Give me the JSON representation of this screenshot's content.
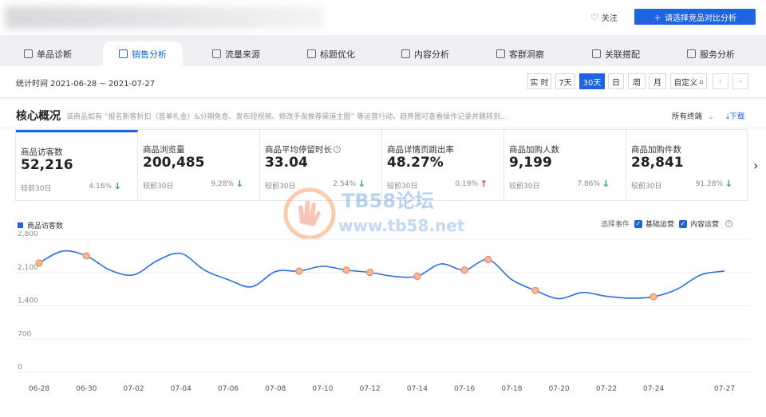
{
  "header": {
    "follow_label": "关注",
    "compare_label": "请选择竞品对比分析"
  },
  "tabs": [
    {
      "label": "单品诊断",
      "icon": "product-icon"
    },
    {
      "label": "销售分析",
      "icon": "bag-icon",
      "active": true
    },
    {
      "label": "流量来源",
      "icon": "traffic-icon"
    },
    {
      "label": "标题优化",
      "icon": "chart-icon"
    },
    {
      "label": "内容分析",
      "icon": "content-icon"
    },
    {
      "label": "客群洞察",
      "icon": "users-icon"
    },
    {
      "label": "关联搭配",
      "icon": "link-icon"
    },
    {
      "label": "服务分析",
      "icon": "headset-icon"
    }
  ],
  "date": {
    "range_label": "统计时间 2021-06-28 ~ 2021-07-27",
    "buttons": [
      "实 时",
      "7天",
      "30天",
      "日",
      "周",
      "月",
      "自定义"
    ],
    "active": "30天"
  },
  "core": {
    "title": "核心概况",
    "description": "该商品如有 “报名新客折扣（首单礼金）&分期免息、发布短视频、修改手淘推荐渠道主图” 等运营行动，趋势图可查看操作记录并跳转到...",
    "terminal_label": "所有终端",
    "download_label": "下载"
  },
  "cards": [
    {
      "label": "商品访客数",
      "value": "52,216",
      "compare": "较前30日",
      "pct": "4.16%",
      "direction": "down"
    },
    {
      "label": "商品浏览量",
      "value": "200,485",
      "compare": "较前30日",
      "pct": "9.28%",
      "direction": "down"
    },
    {
      "label": "商品平均停留时长",
      "value": "33.04",
      "compare": "较前30日",
      "pct": "2.54%",
      "direction": "down",
      "help": true
    },
    {
      "label": "商品详情页跳出率",
      "value": "48.27%",
      "compare": "较前30日",
      "pct": "0.19%",
      "direction": "up"
    },
    {
      "label": "商品加购人数",
      "value": "9,199",
      "compare": "较前30日",
      "pct": "7.86%",
      "direction": "down"
    },
    {
      "label": "商品加购件数",
      "value": "28,841",
      "compare": "较前30日",
      "pct": "91.28%",
      "direction": "down"
    }
  ],
  "events": {
    "label": "选择事件",
    "options": [
      "基础运营",
      "内容运营"
    ]
  },
  "watermark": {
    "line1": "TB58论坛",
    "line2": "www.tb58.net"
  },
  "chart_data": {
    "type": "line",
    "title": "",
    "xlabel": "",
    "ylabel": "",
    "ylim": [
      0,
      2800
    ],
    "yticks": [
      0,
      700,
      1400,
      2100,
      2800
    ],
    "ytick_labels": [
      "0",
      "700",
      "1,400",
      "2,100",
      "2,800"
    ],
    "x": [
      "06-28",
      "06-29",
      "06-30",
      "07-01",
      "07-02",
      "07-03",
      "07-04",
      "07-05",
      "07-06",
      "07-07",
      "07-08",
      "07-09",
      "07-10",
      "07-11",
      "07-12",
      "07-13",
      "07-14",
      "07-15",
      "07-16",
      "07-17",
      "07-18",
      "07-19",
      "07-20",
      "07-21",
      "07-22",
      "07-23",
      "07-24",
      "07-25",
      "07-26",
      "07-27"
    ],
    "xtick_labels": [
      "06-28",
      "06-30",
      "07-02",
      "07-04",
      "07-06",
      "07-08",
      "07-10",
      "07-12",
      "07-14",
      "07-16",
      "07-18",
      "07-20",
      "07-22",
      "07-24",
      "07-27"
    ],
    "series": [
      {
        "name": "商品访客数",
        "color": "#2f6fe3",
        "values": [
          2300,
          2550,
          2450,
          2150,
          2050,
          2350,
          2500,
          2150,
          1950,
          1800,
          2120,
          2130,
          2230,
          2150,
          2100,
          2020,
          2020,
          2280,
          2150,
          2370,
          1950,
          1720,
          1550,
          1680,
          1600,
          1560,
          1590,
          1750,
          2050,
          2130
        ]
      }
    ],
    "event_markers": [
      "06-28",
      "06-30",
      "07-09",
      "07-11",
      "07-12",
      "07-14",
      "07-16",
      "07-17",
      "07-19",
      "07-24"
    ]
  }
}
